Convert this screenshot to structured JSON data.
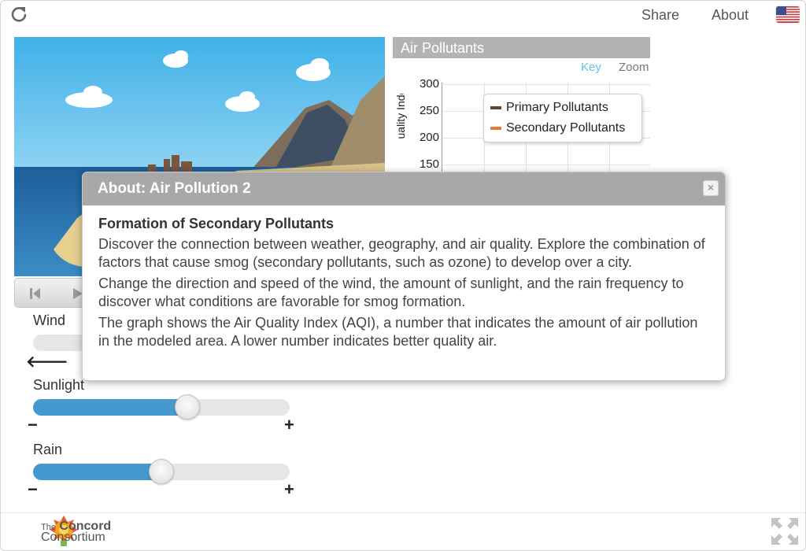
{
  "topbar": {
    "share_label": "Share",
    "about_label": "About"
  },
  "controls": {
    "wind_label": "Wind",
    "sunlight_label": "Sunlight",
    "rain_label": "Rain",
    "minus": "−",
    "plus": "+",
    "wind_arrow": "🡐",
    "sunlight_level": 0.6,
    "rain_level": 0.5
  },
  "graph": {
    "title": "Air Pollutants",
    "key_label": "Key",
    "zoom_label": "Zoom",
    "ylabel_visible": "uality Index)",
    "yticks": [
      "300",
      "250",
      "200",
      "150"
    ],
    "legend": [
      {
        "label": "Primary Pollutants",
        "color": "#5a4a3c"
      },
      {
        "label": "Secondary Pollutants",
        "color": "#e8792c"
      }
    ]
  },
  "dialog": {
    "title": "About: Air Pollution 2",
    "heading": "Formation of Secondary Pollutants",
    "paragraphs": [
      "Discover the connection between weather, geography, and air quality. Explore the combination of factors that cause smog (secondary pollutants, such as ozone) to develop over a city.",
      "Change the direction and speed of the wind, the amount of sunlight, and the rain frequency to discover what conditions are favorable for smog formation.",
      "The graph shows the Air Quality Index (AQI), a number that indicates the amount of air pollution in the modeled area. A lower number indicates better quality air."
    ],
    "close_icon": "close-icon"
  },
  "footer": {
    "logo_line1": "The",
    "logo_line1_bold": "Concord",
    "logo_line2": "Consortium"
  }
}
